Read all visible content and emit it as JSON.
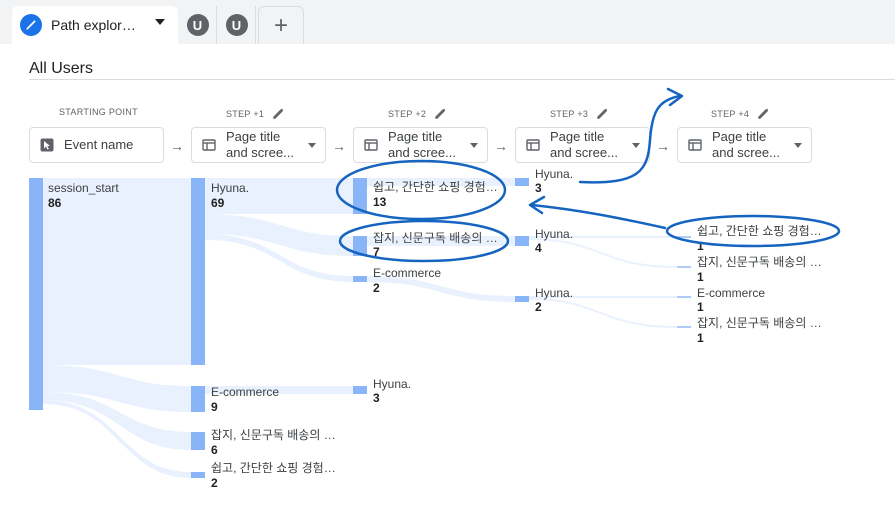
{
  "tabs": {
    "active_label": "Path explorati...",
    "user_avatar_1": "U",
    "user_avatar_2": "U",
    "add_label": "+"
  },
  "segment": "All Users",
  "columns": {
    "start": {
      "header": "STARTING POINT",
      "dimension": "Event name"
    },
    "step1": {
      "header": "STEP +1",
      "dimension_line1": "Page title",
      "dimension_line2": "and scree..."
    },
    "step2": {
      "header": "STEP +2",
      "dimension_line1": "Page title",
      "dimension_line2": "and scree..."
    },
    "step3": {
      "header": "STEP +3",
      "dimension_line1": "Page title",
      "dimension_line2": "and scree..."
    },
    "step4": {
      "header": "STEP +4",
      "dimension_line1": "Page title",
      "dimension_line2": "and scree..."
    }
  },
  "nodes": {
    "start": [
      {
        "label": "session_start",
        "count": "86"
      }
    ],
    "step1": [
      {
        "label": "Hyuna.",
        "count": "69"
      },
      {
        "label": "E-commerce",
        "count": "9"
      },
      {
        "label": "잡지, 신문구독 배송의 모...",
        "count": "6"
      },
      {
        "label": "쉽고, 간단한 쇼핑 경험이...",
        "count": "2"
      }
    ],
    "step2": [
      {
        "label": "쉽고, 간단한 쇼핑 경험이...",
        "count": "13"
      },
      {
        "label": "잡지, 신문구독 배송의 모...",
        "count": "7"
      },
      {
        "label": "E-commerce",
        "count": "2"
      },
      {
        "label": "Hyuna.",
        "count": "3"
      }
    ],
    "step3": [
      {
        "label": "Hyuna.",
        "count": "3"
      },
      {
        "label": "Hyuna.",
        "count": "4"
      },
      {
        "label": "Hyuna.",
        "count": "2"
      }
    ],
    "step4": [
      {
        "label": "쉽고, 간단한 쇼핑 경험이...",
        "count": "1"
      },
      {
        "label": "잡지, 신문구독 배송의 모...",
        "count": "1"
      },
      {
        "label": "E-commerce",
        "count": "1"
      },
      {
        "label": "잡지, 신문구독 배송의 모...",
        "count": "1"
      }
    ]
  },
  "colors": {
    "bar": "#8ab4f8",
    "flow": "#e8f0fe",
    "annotation": "#1565c0",
    "tab_icon": "#1a73e8"
  }
}
